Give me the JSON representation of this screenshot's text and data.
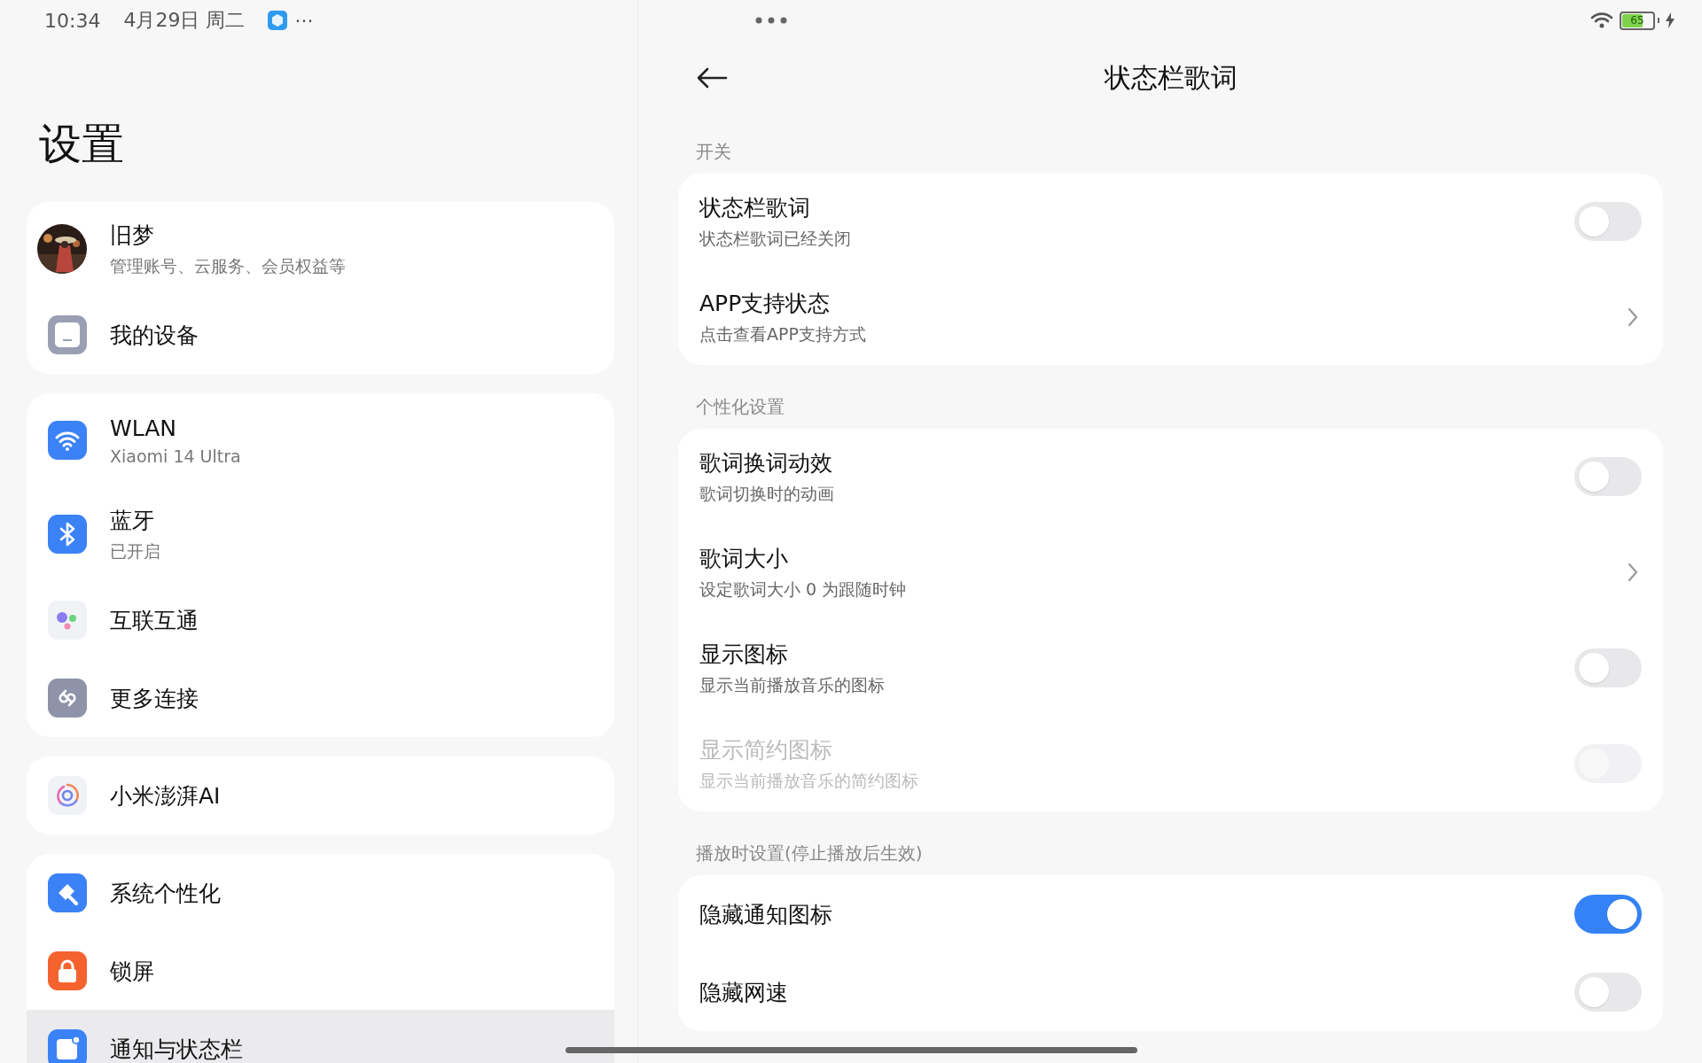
{
  "status_bar": {
    "time": "10:34",
    "date": "4月29日 周二",
    "more": "···",
    "battery": "65"
  },
  "sidebar": {
    "title": "设置",
    "groups": [
      {
        "items": [
          {
            "kind": "account",
            "title": "旧梦",
            "subtitle": "管理账号、云服务、会员权益等",
            "selected": false
          },
          {
            "kind": "item",
            "title": "我的设备",
            "selected": false
          }
        ]
      },
      {
        "items": [
          {
            "kind": "item",
            "title": "WLAN",
            "subtitle": "Xiaomi 14 Ultra",
            "selected": false
          },
          {
            "kind": "item",
            "title": "蓝牙",
            "subtitle": "已开启",
            "selected": false
          },
          {
            "kind": "item",
            "title": "互联互通",
            "selected": false
          },
          {
            "kind": "item",
            "title": "更多连接",
            "selected": false
          }
        ]
      },
      {
        "items": [
          {
            "kind": "item",
            "title": "小米澎湃AI",
            "selected": false
          }
        ]
      },
      {
        "items": [
          {
            "kind": "item",
            "title": "系统个性化",
            "selected": false
          },
          {
            "kind": "item",
            "title": "锁屏",
            "selected": false
          },
          {
            "kind": "item",
            "title": "通知与状态栏",
            "selected": true
          }
        ]
      }
    ]
  },
  "detail": {
    "title": "状态栏歌词",
    "sections": [
      {
        "label": "开关",
        "rows": [
          {
            "kind": "toggle",
            "title": "状态栏歌词",
            "subtitle": "状态栏歌词已经关闭",
            "on": false,
            "disabled": false
          },
          {
            "kind": "link",
            "title": "APP支持状态",
            "subtitle": "点击查看APP支持方式",
            "disabled": false
          }
        ]
      },
      {
        "label": "个性化设置",
        "rows": [
          {
            "kind": "toggle",
            "title": "歌词换词动效",
            "subtitle": "歌词切换时的动画",
            "on": false,
            "disabled": false
          },
          {
            "kind": "link",
            "title": "歌词大小",
            "subtitle": "设定歌词大小 0 为跟随时钟",
            "disabled": false
          },
          {
            "kind": "toggle",
            "title": "显示图标",
            "subtitle": "显示当前播放音乐的图标",
            "on": false,
            "disabled": false
          },
          {
            "kind": "toggle",
            "title": "显示简约图标",
            "subtitle": "显示当前播放音乐的简约图标",
            "on": false,
            "disabled": true
          }
        ]
      },
      {
        "label": "播放时设置(停止播放后生效)",
        "rows": [
          {
            "kind": "toggle",
            "title": "隐藏通知图标",
            "on": true,
            "disabled": false
          },
          {
            "kind": "toggle",
            "title": "隐藏网速",
            "on": false,
            "disabled": false
          }
        ]
      }
    ]
  }
}
